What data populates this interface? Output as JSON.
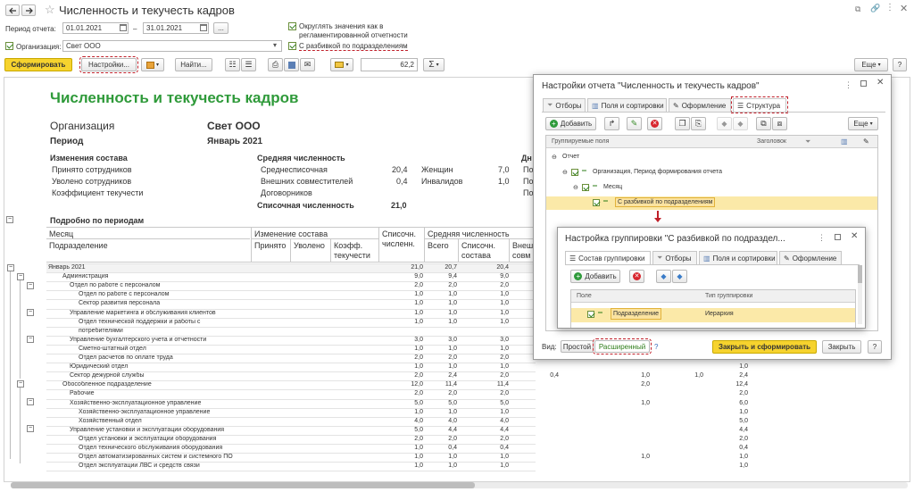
{
  "window": {
    "title": "Численность и текучесть кадров"
  },
  "filters": {
    "period_label": "Период отчета:",
    "date_from": "01.01.2021",
    "date_to": "31.01.2021",
    "dash": "–",
    "more_btn": "...",
    "org_label": "Организация:",
    "org_value": "Свет ООО",
    "round_label_1": "Округлять значения как в",
    "round_label_2": "регламентированной отчетности",
    "breakdown_label": "С разбивкой по подразделениям"
  },
  "toolbar": {
    "generate": "Сформировать",
    "settings": "Настройки...",
    "find": "Найти...",
    "scale_value": "62,2",
    "sigma": "Σ",
    "more": "Еще"
  },
  "report": {
    "title": "Численность и текучесть кадров",
    "org_label": "Организация",
    "org_value": "Свет ООО",
    "period_label": "Период",
    "period_value": "Январь 2021",
    "changes_header": "Изменения состава",
    "hired_label": "Принято сотрудников",
    "fired_label": "Уволено сотрудников",
    "turnover_label": "Коэффициент текучести",
    "avg_header": "Средняя численность",
    "avg_list_label": "Среднесписочная",
    "avg_list_value": "20,4",
    "external_label": "Внешних совместителей",
    "external_value": "0,4",
    "contracts_label": "Договорников",
    "list_count_label": "Списочная численность",
    "list_count_value": "21,0",
    "women_label": "Женщин",
    "women_value": "7,0",
    "disabled_label": "Инвалидов",
    "disabled_value": "1,0",
    "cut_dn": "Дн",
    "cut_po": "По",
    "detail_header": "Подробно по периодам",
    "col_month": "Месяц",
    "col_dept": "Подразделение",
    "col_changes": "Изменение состава",
    "col_hired": "Принято",
    "col_fired": "Уволено",
    "col_coef1": "Коэфф.",
    "col_coef2": "текучести",
    "col_list1": "Списочн.",
    "col_list2": "численн.",
    "col_avg": "Средняя численность",
    "col_total": "Всего",
    "col_avglist1": "Списочн.",
    "col_avglist2": "состава",
    "col_ext1": "Внеш",
    "col_ext2": "совм",
    "rows": [
      {
        "name": "Январь 2021",
        "indent": 0,
        "list": "21,0",
        "total": "20,7",
        "avg": "20,4"
      },
      {
        "name": "Администрация",
        "indent": 1,
        "list": "9,0",
        "total": "9,4",
        "avg": "9,0"
      },
      {
        "name": "Отдел по работе с персоналом",
        "indent": 2,
        "list": "2,0",
        "total": "2,0",
        "avg": "2,0"
      },
      {
        "name": "Отдел по работе с персоналом",
        "indent": 3,
        "list": "1,0",
        "total": "1,0",
        "avg": "1,0"
      },
      {
        "name": "Сектор развития персонала",
        "indent": 3,
        "list": "1,0",
        "total": "1,0",
        "avg": "1,0"
      },
      {
        "name": "Управление маркетинга и обслуживания клиентов",
        "indent": 2,
        "list": "1,0",
        "total": "1,0",
        "avg": "1,0"
      },
      {
        "name": "Отдел технической поддержки и работы с",
        "indent": 3,
        "list": "1,0",
        "total": "1,0",
        "avg": "1,0"
      },
      {
        "name": "потребителями",
        "indent": 3,
        "list": "",
        "total": "",
        "avg": ""
      },
      {
        "name": "Управление бухгалтерского учета и отчетности",
        "indent": 2,
        "list": "3,0",
        "total": "3,0",
        "avg": "3,0"
      },
      {
        "name": "Сметно-штатный отдел",
        "indent": 3,
        "list": "1,0",
        "total": "1,0",
        "avg": "1,0"
      },
      {
        "name": "Отдел расчетов по оплате труда",
        "indent": 3,
        "list": "2,0",
        "total": "2,0",
        "avg": "2,0"
      },
      {
        "name": "Юридический отдел",
        "indent": 2,
        "list": "1,0",
        "total": "1,0",
        "avg": "1,0"
      },
      {
        "name": "Сектор дежурной службы",
        "indent": 2,
        "list": "2,0",
        "total": "2,4",
        "avg": "2,0"
      },
      {
        "name": "Обособленное подразделение",
        "indent": 1,
        "list": "12,0",
        "total": "11,4",
        "avg": "11,4"
      },
      {
        "name": "Рабочие",
        "indent": 2,
        "list": "2,0",
        "total": "2,0",
        "avg": "2,0"
      },
      {
        "name": "Хозяйственно-эксплуатационное управление",
        "indent": 2,
        "list": "5,0",
        "total": "5,0",
        "avg": "5,0"
      },
      {
        "name": "Хозяйственно-эксплуатационное управление",
        "indent": 3,
        "list": "1,0",
        "total": "1,0",
        "avg": "1,0"
      },
      {
        "name": "Хозяйственный отдел",
        "indent": 3,
        "list": "4,0",
        "total": "4,0",
        "avg": "4,0"
      },
      {
        "name": "Управление установки и эксплуатации оборудования",
        "indent": 2,
        "list": "5,0",
        "total": "4,4",
        "avg": "4,4"
      },
      {
        "name": "Отдел установки и эксплуатации оборудования",
        "indent": 3,
        "list": "2,0",
        "total": "2,0",
        "avg": "2,0"
      },
      {
        "name": "Отдел технического обслуживания оборудования",
        "indent": 3,
        "list": "1,0",
        "total": "0,4",
        "avg": "0,4"
      },
      {
        "name": "Отдел автоматизированных систем и системного ПО",
        "indent": 3,
        "list": "1,0",
        "total": "1,0",
        "avg": "1,0"
      },
      {
        "name": "Отдел эксплуатации ЛВС и средств связи",
        "indent": 3,
        "list": "1,0",
        "total": "1,0",
        "avg": "1,0"
      }
    ],
    "right_rows": [
      {
        "a": "",
        "b": "",
        "c": "",
        "d": "1,0"
      },
      {
        "a": "0,4",
        "b": "1,0",
        "c": "1,0",
        "d": "2,4"
      },
      {
        "a": "",
        "b": "2,0",
        "c": "",
        "d": "12,4"
      },
      {
        "a": "",
        "b": "",
        "c": "",
        "d": "2,0"
      },
      {
        "a": "",
        "b": "1,0",
        "c": "",
        "d": "6,0"
      },
      {
        "a": "",
        "b": "",
        "c": "",
        "d": "1,0"
      },
      {
        "a": "",
        "b": "",
        "c": "",
        "d": "5,0"
      },
      {
        "a": "",
        "b": "",
        "c": "",
        "d": "4,4"
      },
      {
        "a": "",
        "b": "",
        "c": "",
        "d": "2,0"
      },
      {
        "a": "",
        "b": "",
        "c": "",
        "d": "0,4"
      },
      {
        "a": "",
        "b": "1,0",
        "c": "",
        "d": "1,0"
      },
      {
        "a": "",
        "b": "",
        "c": "",
        "d": "1,0"
      }
    ]
  },
  "settings_dialog": {
    "title": "Настройки отчета \"Численность и текучесть кадров\"",
    "tabs": [
      "Отборы",
      "Поля и сортировки",
      "Оформление",
      "Структура"
    ],
    "add_btn": "Добавить",
    "more_btn": "Еще",
    "col_fields": "Группируемые поля",
    "col_header": "Заголовок",
    "tree": [
      "Отчет",
      "Организация, Период формирования отчета",
      "Месяц",
      "С разбивкой по подразделениям"
    ],
    "view_label": "Вид:",
    "view_simple": "Простой",
    "view_extended": "Расширенный",
    "help": "?",
    "close_generate": "Закрыть и сформировать",
    "close": "Закрыть",
    "help2": "?"
  },
  "grouping_dialog": {
    "title": "Настройка группировки \"С разбивкой по подраздел...",
    "tabs": [
      "Состав группировки",
      "Отборы",
      "Поля и сортировки",
      "Оформление"
    ],
    "add_btn": "Добавить",
    "col_field": "Поле",
    "col_type": "Тип группировки",
    "row_field": "Подразделение",
    "row_type": "Иерархия"
  },
  "colors": {
    "accent_green": "#2f9a3a",
    "generate_yellow": "#f6d32e",
    "dash_red": "#c0202a",
    "highlight_yellow": "#fbe9a8"
  }
}
